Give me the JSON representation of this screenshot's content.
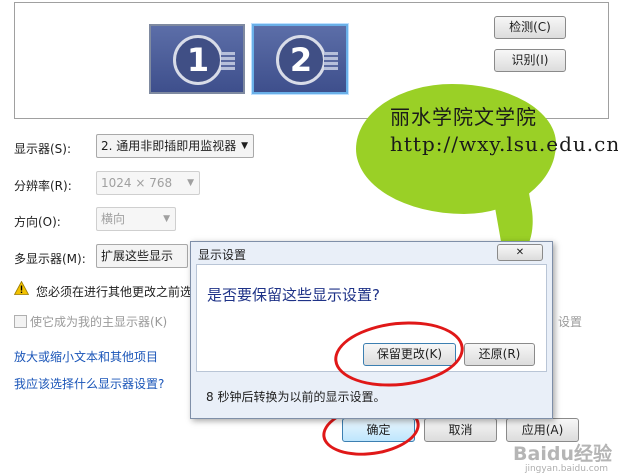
{
  "preview": {
    "monitor1_number": "1",
    "monitor2_number": "2",
    "detect_label": "检测(C)",
    "identify_label": "识别(I)"
  },
  "form": {
    "display_label": "显示器(S):",
    "display_value": "2. 通用非即插即用监视器",
    "resolution_label": "分辨率(R):",
    "resolution_value": "1024 × 768",
    "orientation_label": "方向(O):",
    "orientation_value": "横向",
    "multi_label": "多显示器(M):",
    "multi_value": "扩展这些显示",
    "warning_text": "您必须在进行其他更改之前选",
    "primary_checkbox_label": "使它成为我的主显示器(K)",
    "advanced_partial": "设置",
    "link_text_size": "放大或缩小文本和其他项目",
    "link_which_settings": "我应该选择什么显示器设置?"
  },
  "bubble": {
    "text": "丽水学院文学院http://wxy.lsu.edu.cn/"
  },
  "dialog": {
    "title": "显示设置",
    "close_glyph": "✕",
    "question": "是否要保留这些显示设置?",
    "keep_label": "保留更改(K)",
    "revert_label": "还原(R)",
    "countdown_text": "8 秒钟后转换为以前的显示设置。"
  },
  "footer": {
    "ok_label": "确定",
    "cancel_label": "取消",
    "apply_label": "应用(A)"
  },
  "watermark": {
    "main": "Baidu经验",
    "sub": "jingyan.baidu.com"
  },
  "colors": {
    "accent_link": "#1a55b8",
    "bubble_green": "#9ad026",
    "annotation_red": "#e01818",
    "warning_yellow": "#f2c200"
  }
}
